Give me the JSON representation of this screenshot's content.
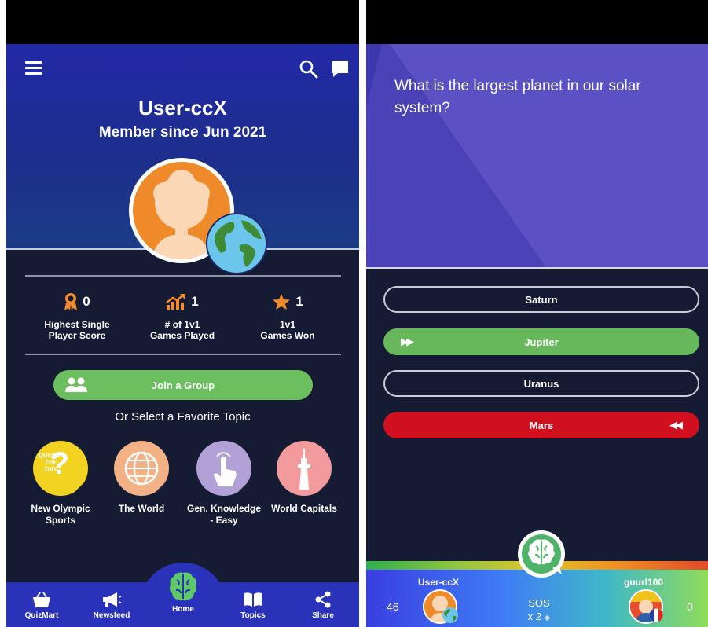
{
  "left": {
    "profile": {
      "username": "User-ccX",
      "member_since": "Member since Jun 2021"
    },
    "stats": [
      {
        "value": "0",
        "label_line1": "Highest Single",
        "label_line2": "Player Score",
        "icon": "ribbon-medal-icon"
      },
      {
        "value": "1",
        "label_line1": "# of 1v1",
        "label_line2": "Games Played",
        "icon": "trending-chart-icon"
      },
      {
        "value": "1",
        "label_line1": "1v1",
        "label_line2": "Games Won",
        "icon": "star-icon"
      }
    ],
    "join_group": "Join a Group",
    "or_select": "Or Select a Favorite Topic",
    "topics": [
      {
        "line1": "New Olympic",
        "line2": "Sports",
        "color": "#f3d321",
        "badge": "QUIZ OF THE DAY"
      },
      {
        "line1": "The World",
        "line2": "",
        "color": "#f2b286"
      },
      {
        "line1": "Gen. Knowledge",
        "line2": "- Easy",
        "color": "#b2a1d6"
      },
      {
        "line1": "World Capitals",
        "line2": "",
        "color": "#f39a9c"
      }
    ],
    "nav": {
      "quizmart": "QuizMart",
      "newsfeed": "Newsfeed",
      "home": "Home",
      "topics": "Topics",
      "share": "Share"
    }
  },
  "right": {
    "question": "What is the largest planet in our solar system?",
    "answers": [
      {
        "text": "Saturn",
        "state": "outline"
      },
      {
        "text": "Jupiter",
        "state": "correct"
      },
      {
        "text": "Uranus",
        "state": "outline"
      },
      {
        "text": "Mars",
        "state": "wrong"
      }
    ],
    "player1": {
      "name": "User-ccX",
      "score": "46"
    },
    "player2": {
      "name": "guurl100",
      "score": "0"
    },
    "sos_label": "SOS",
    "sos_count": "x 2"
  },
  "colors": {
    "green": "#6cbf5e",
    "red": "#d0101e",
    "navy": "#141b33",
    "nav_blue": "#2a32b9"
  }
}
